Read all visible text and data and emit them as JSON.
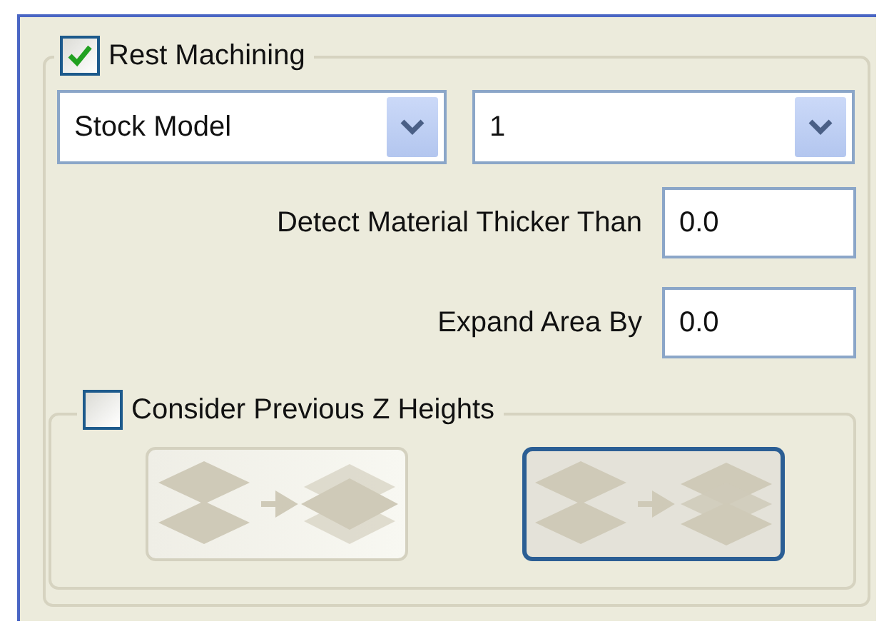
{
  "rest_machining": {
    "label": "Rest Machining",
    "checked": true,
    "source": {
      "value": "Stock Model"
    },
    "index": {
      "value": "1"
    },
    "fields": [
      {
        "label": "Detect Material Thicker Than",
        "value": "0.0"
      },
      {
        "label": "Expand Area By",
        "value": "0.0"
      }
    ],
    "consider_previous_z": {
      "label": "Consider Previous Z Heights",
      "checked": false,
      "options": [
        {
          "kind": "merge",
          "selected": false
        },
        {
          "kind": "stack",
          "selected": true
        }
      ]
    }
  }
}
